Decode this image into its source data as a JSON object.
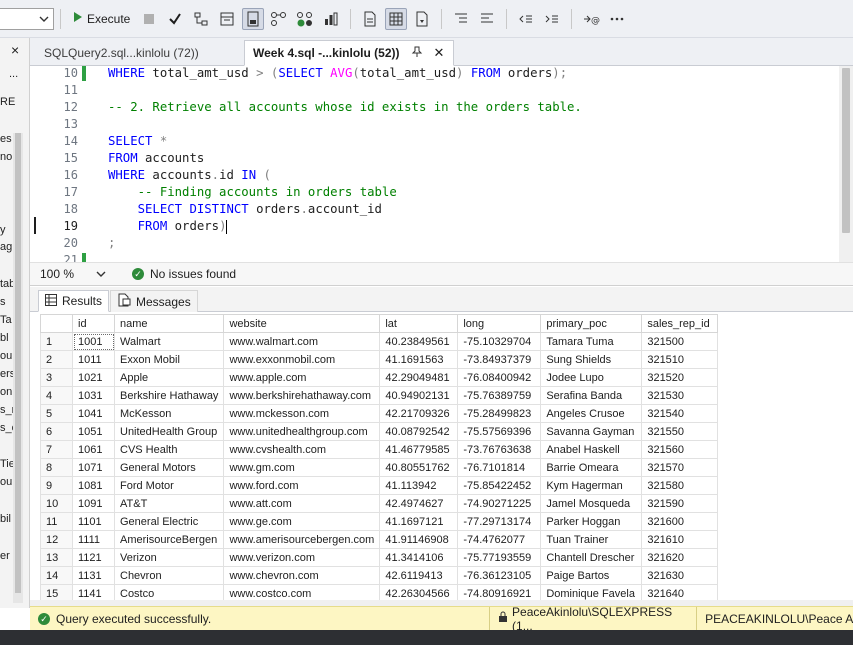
{
  "toolbar": {
    "execute_label": "Execute",
    "icons": [
      "database-dropdown-chevron",
      "play-icon",
      "stop-icon",
      "parse-check-icon",
      "display-plan-icon",
      "query-designer-icon",
      "results-to-icon",
      "include-plan-icon",
      "live-stats-icon",
      "client-stats-icon",
      "results-to-text-icon",
      "results-to-grid-icon",
      "results-to-file-icon",
      "comment-icon",
      "uncomment-icon",
      "decrease-indent-icon",
      "increase-indent-icon",
      "specify-values-icon",
      "more-icon"
    ]
  },
  "left_strip": {
    "fragments": [
      "×",
      "...",
      "RE",
      "es",
      "no",
      "y",
      "ag",
      "tab",
      "s",
      "Ta",
      "bl",
      "ou",
      "ers",
      "on",
      "s_r",
      "s_e",
      "Tie",
      "ou",
      "bil",
      "er"
    ]
  },
  "tabs": [
    {
      "label": "SQLQuery2.sql...kinlolu (72))",
      "active": false
    },
    {
      "label": "Week 4.sql -...kinlolu (52))",
      "active": true
    }
  ],
  "tab_icons": {
    "pin": "⊿",
    "close": "✕"
  },
  "editor": {
    "line_numbers": [
      "10",
      "11",
      "12",
      "13",
      "14",
      "15",
      "16",
      "17",
      "18",
      "19",
      "20",
      "21"
    ],
    "lines": [
      {
        "text": "WHERE total_amt_usd > (SELECT AVG(total_amt_usd) FROM orders);"
      },
      {
        "text": ""
      },
      {
        "text": "-- 2. Retrieve all accounts whose id exists in the orders table."
      },
      {
        "text": ""
      },
      {
        "text": "SELECT *"
      },
      {
        "text": "FROM accounts"
      },
      {
        "text": "WHERE accounts.id IN ("
      },
      {
        "text": "    -- Finding accounts in orders table"
      },
      {
        "text": "    SELECT DISTINCT orders.account_id"
      },
      {
        "text": "    FROM orders)"
      },
      {
        "text": ";"
      },
      {
        "text": ""
      }
    ]
  },
  "editor_status": {
    "zoom": "100 %",
    "issues": "No issues found"
  },
  "result_tabs": [
    {
      "label": "Results",
      "active": true
    },
    {
      "label": "Messages",
      "active": false
    }
  ],
  "grid": {
    "columns": [
      "",
      "id",
      "name",
      "website",
      "lat",
      "long",
      "primary_poc",
      "sales_rep_id"
    ],
    "rows": [
      [
        "1",
        "1001",
        "Walmart",
        "www.walmart.com",
        "40.23849561",
        "-75.10329704",
        "Tamara Tuma",
        "321500"
      ],
      [
        "2",
        "1011",
        "Exxon Mobil",
        "www.exxonmobil.com",
        "41.1691563",
        "-73.84937379",
        "Sung Shields",
        "321510"
      ],
      [
        "3",
        "1021",
        "Apple",
        "www.apple.com",
        "42.29049481",
        "-76.08400942",
        "Jodee Lupo",
        "321520"
      ],
      [
        "4",
        "1031",
        "Berkshire Hathaway",
        "www.berkshirehathaway.com",
        "40.94902131",
        "-75.76389759",
        "Serafina Banda",
        "321530"
      ],
      [
        "5",
        "1041",
        "McKesson",
        "www.mckesson.com",
        "42.21709326",
        "-75.28499823",
        "Angeles Crusoe",
        "321540"
      ],
      [
        "6",
        "1051",
        "UnitedHealth Group",
        "www.unitedhealthgroup.com",
        "40.08792542",
        "-75.57569396",
        "Savanna Gayman",
        "321550"
      ],
      [
        "7",
        "1061",
        "CVS Health",
        "www.cvshealth.com",
        "41.46779585",
        "-73.76763638",
        "Anabel Haskell",
        "321560"
      ],
      [
        "8",
        "1071",
        "General Motors",
        "www.gm.com",
        "40.80551762",
        "-76.7101814",
        "Barrie Omeara",
        "321570"
      ],
      [
        "9",
        "1081",
        "Ford Motor",
        "www.ford.com",
        "41.113942",
        "-75.85422452",
        "Kym Hagerman",
        "321580"
      ],
      [
        "10",
        "1091",
        "AT&T",
        "www.att.com",
        "42.4974627",
        "-74.90271225",
        "Jamel Mosqueda",
        "321590"
      ],
      [
        "11",
        "1101",
        "General Electric",
        "www.ge.com",
        "41.1697121",
        "-77.29713174",
        "Parker Hoggan",
        "321600"
      ],
      [
        "12",
        "1111",
        "AmerisourceBergen",
        "www.amerisourcebergen.com",
        "41.91146908",
        "-74.4762077",
        "Tuan Trainer",
        "321610"
      ],
      [
        "13",
        "1121",
        "Verizon",
        "www.verizon.com",
        "41.3414106",
        "-75.77193559",
        "Chantell Drescher",
        "321620"
      ],
      [
        "14",
        "1131",
        "Chevron",
        "www.chevron.com",
        "42.6119413",
        "-76.36123105",
        "Paige Bartos",
        "321630"
      ],
      [
        "15",
        "1141",
        "Costco",
        "www.costco.com",
        "42.26304566",
        "-74.80916921",
        "Dominique Favela",
        "321640"
      ]
    ]
  },
  "status": {
    "message": "Query executed successfully.",
    "server": "PeaceAkinlolu\\SQLEXPRESS (1...",
    "user": "PEACEAKINLOLU\\Peace Ak"
  },
  "colors": {
    "keyword": "#0000ff",
    "function": "#ff00ff",
    "comment": "#008000",
    "status_bar": "#fdf6c3",
    "change_bar": "#2ea043"
  }
}
